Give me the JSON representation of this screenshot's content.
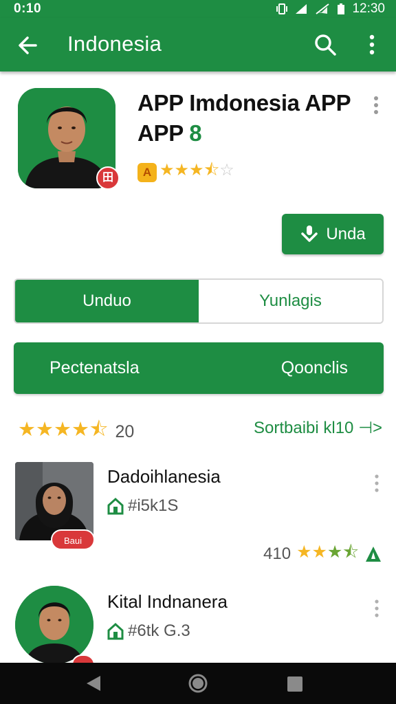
{
  "status_bar": {
    "time_left": "0:10",
    "time_right": "12:30",
    "icons": [
      "vibrate-icon",
      "signal-icon",
      "wifi-off-icon",
      "battery-icon"
    ]
  },
  "app_bar": {
    "title": "Indonesia",
    "icons": [
      "back-arrow-icon",
      "search-icon",
      "more-vert-icon"
    ]
  },
  "app_header": {
    "title_line1": "APP Imdonesia APP",
    "title_line2_prefix": "APP",
    "title_line2_accent": "8",
    "icon_badge": "田",
    "rating_badge": "A",
    "rating_stars": 3.5,
    "install_button": "Unda"
  },
  "toggle": {
    "active_label": "Unduo",
    "inactive_label": "Yunlagis"
  },
  "green_bar": {
    "left_label": "Pectenatsla",
    "right_label": "Qoonclis"
  },
  "ratings_summary": {
    "stars": 4.5,
    "count": "20",
    "sort_label": "Sortbaibi kl10 ⊣>"
  },
  "reviews": [
    {
      "name": "Dadoihlanesia",
      "sub": "#i5k1S",
      "badge": "Baui",
      "rating_num": "410",
      "stars": 3.5
    },
    {
      "name": "Kital Indnanera",
      "sub": "#6tk G.3",
      "badge": ""
    }
  ],
  "colors": {
    "primary": "#1e8d43",
    "star": "#f5b623",
    "badge_red": "#d9383a",
    "nav_bg": "#0a0a0a"
  }
}
